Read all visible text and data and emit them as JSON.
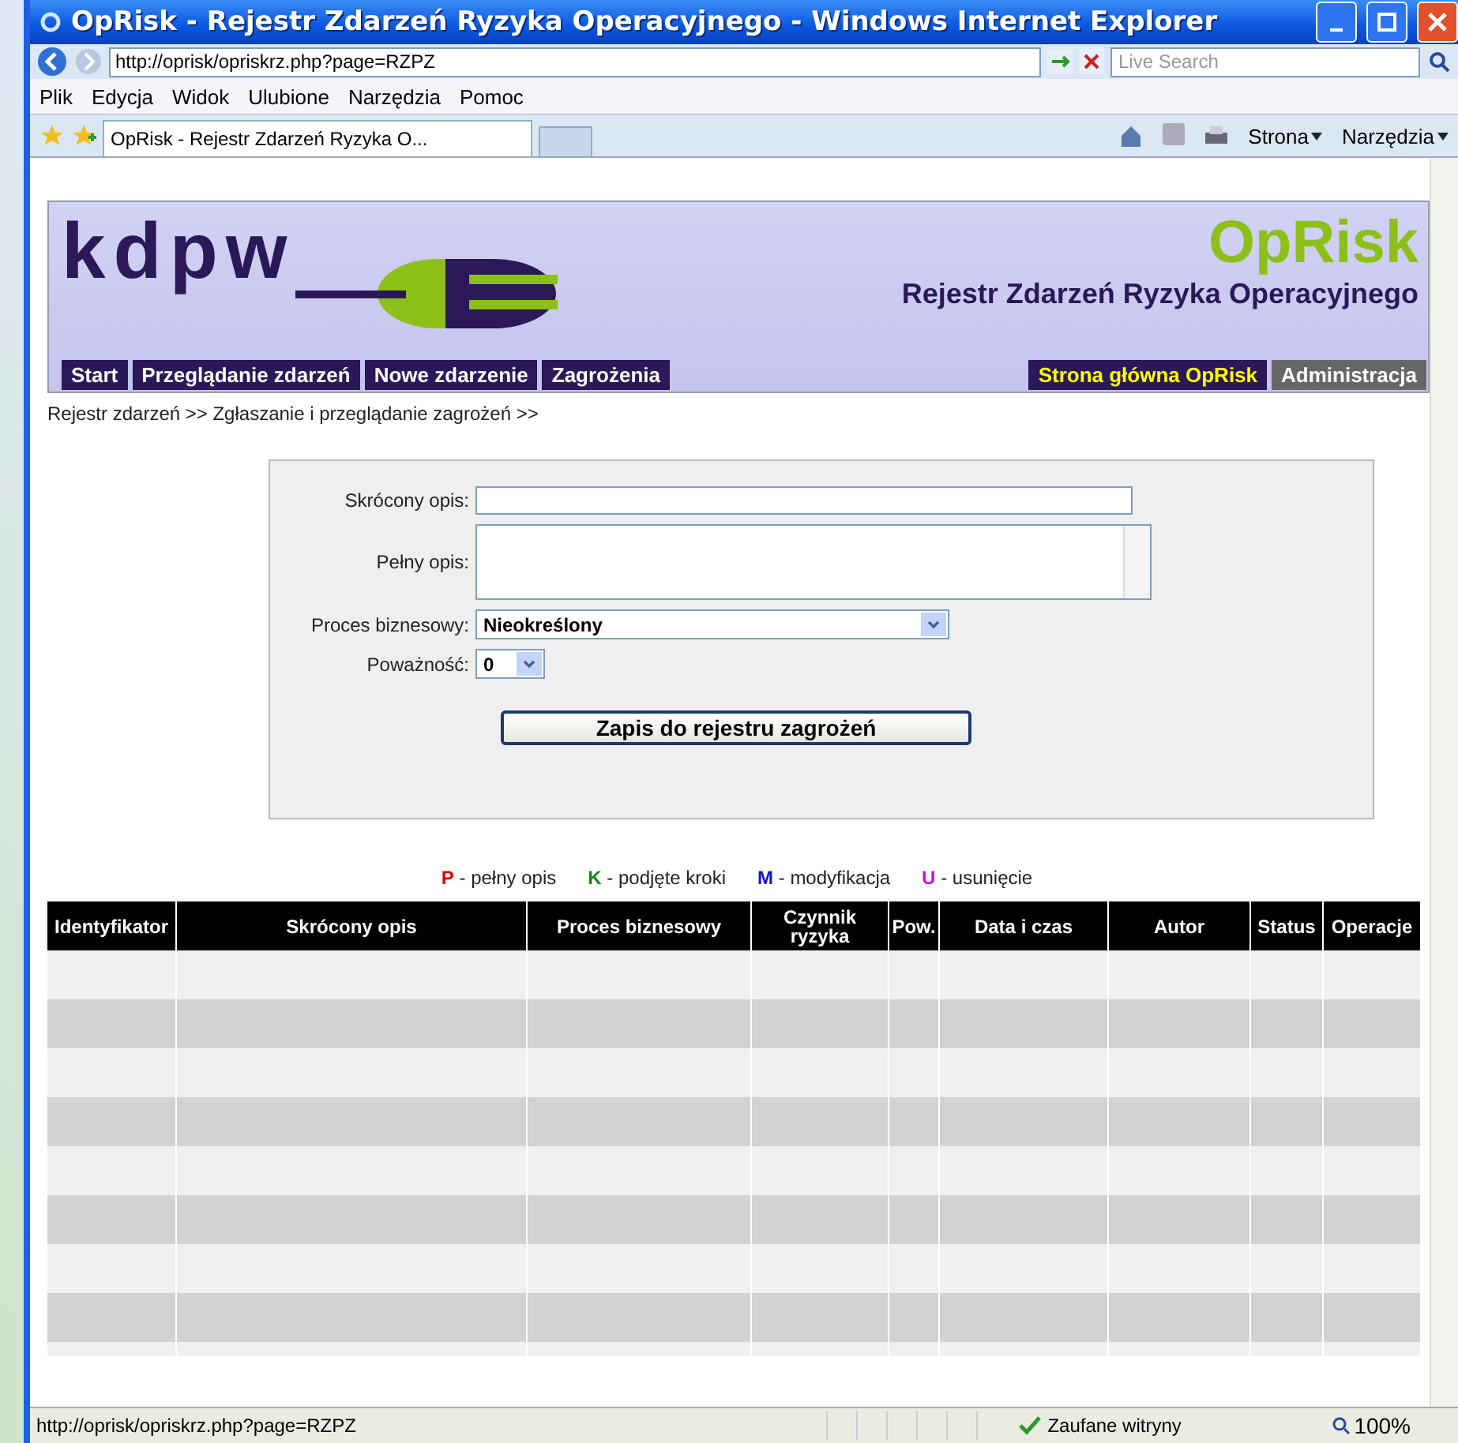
{
  "window": {
    "title": "OpRisk - Rejestr Zdarzeń Ryzyka Operacyjnego - Windows Internet Explorer"
  },
  "address_bar": {
    "url": "http://oprisk/opriskrz.php?page=RZPZ",
    "search_placeholder": "Live Search"
  },
  "menu": [
    "Plik",
    "Edycja",
    "Widok",
    "Ulubione",
    "Narzędzia",
    "Pomoc"
  ],
  "tabs": [
    {
      "label": "OpRisk - Rejestr Zdarzeń Ryzyka O...",
      "selected": true
    }
  ],
  "toolbar": {
    "page_button": "Strona",
    "tools_button": "Narzędzia"
  },
  "banner": {
    "logo": "kdpw",
    "app_name": "OpRisk",
    "subtitle": "Rejestr Zdarzeń Ryzyka Operacyjnego"
  },
  "nav_left": [
    {
      "label": "Start",
      "selected": false
    },
    {
      "label": "Przeglądanie zdarzeń",
      "selected": false
    },
    {
      "label": "Nowe zdarzenie",
      "selected": false
    },
    {
      "label": "Zagrożenia",
      "selected": false
    }
  ],
  "nav_right": [
    {
      "label": "Strona główna OpRisk",
      "selected": true,
      "kind": "main"
    },
    {
      "label": "Administracja",
      "selected": false,
      "kind": "admin"
    }
  ],
  "breadcrumb": "Rejestr zdarzeń >> Zgłaszanie i przeglądanie zagrożeń >>",
  "form": {
    "short_label": "Skrócony opis:",
    "full_label": "Pełny opis:",
    "process_label": "Proces biznesowy:",
    "process_value": "Nieokreślony",
    "severity_label": "Poważność:",
    "severity_value": "0",
    "submit": "Zapis do rejestru zagrożeń"
  },
  "legend": [
    {
      "letter": "P",
      "text": "- pełny opis",
      "color": "#dd0000"
    },
    {
      "letter": "K",
      "text": "- podjęte kroki",
      "color": "#118811"
    },
    {
      "letter": "M",
      "text": "- modyfikacja",
      "color": "#1111dd"
    },
    {
      "letter": "U",
      "text": "- usunięcie",
      "color": "#cc11cc"
    }
  ],
  "table": {
    "columns": [
      "Identyfikator",
      "Skrócony opis",
      "Proces biznesowy",
      "Czynnik ryzyka",
      "Pow.",
      "Data i czas",
      "Autor",
      "Status",
      "Operacje"
    ],
    "rows": [
      {
        "striped": false
      },
      {
        "striped": true
      },
      {
        "striped": false
      },
      {
        "striped": true
      },
      {
        "striped": false
      },
      {
        "striped": true
      },
      {
        "striped": false
      },
      {
        "striped": true
      },
      {
        "striped": false
      }
    ]
  },
  "status_bar": {
    "url": "http://oprisk/opriskrz.php?page=RZPZ",
    "zone": "Zaufane witryny",
    "zoom": "100%"
  }
}
